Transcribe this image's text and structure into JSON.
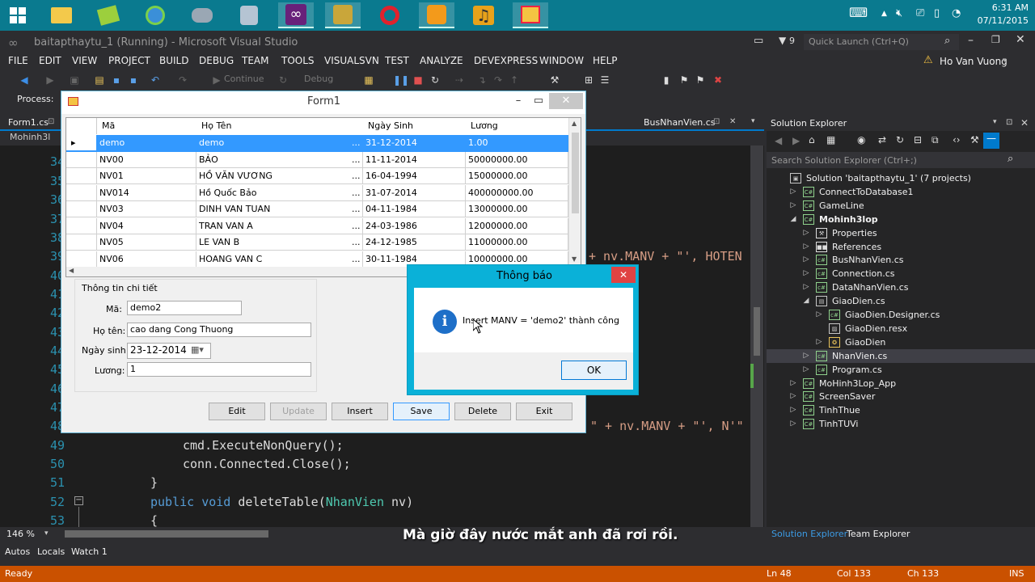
{
  "taskbar": {
    "clock_time": "6:31 AM",
    "clock_date": "07/11/2015"
  },
  "vs": {
    "title": "baitapthaytu_1 (Running) - Microsoft Visual Studio",
    "notifications": "9",
    "quick_launch_placeholder": "Quick Launch (Ctrl+Q)",
    "user_name": "Ho Van Vuong",
    "menu": [
      "FILE",
      "EDIT",
      "VIEW",
      "PROJECT",
      "BUILD",
      "DEBUG",
      "TEAM",
      "TOOLS",
      "VISUALSVN",
      "TEST",
      "ANALYZE",
      "DEVEXPRESS",
      "WINDOW",
      "HELP"
    ],
    "continue_label": "Continue",
    "config_label": "Debug",
    "process_label": "Process:",
    "doc_tab_left": "Form1.cs",
    "doc_tab_right": "BusNhanVien.cs",
    "nav_left": "Mohinh3l",
    "zoom": "146 %"
  },
  "editor": {
    "line_numbers": [
      "34",
      "35",
      "36",
      "37",
      "38",
      "39",
      "40",
      "41",
      "42",
      "43",
      "44",
      "45",
      "46",
      "47",
      "48",
      "49",
      "50",
      "51",
      "52",
      "53"
    ],
    "frag_39": "+ nv.MANV + \"', HOTEN",
    "frag_48": "\" + nv.MANV + \"', N'\"",
    "line_49": "cmd.ExecuteNonQuery();",
    "line_50": "conn.Connected.Close();",
    "line_51": "}",
    "line_52_kw1": "public",
    "line_52_kw2": "void",
    "line_52_name": "deleteTable(",
    "line_52_type": "NhanVien",
    "line_52_rest": " nv)",
    "line_53": "{"
  },
  "solution_explorer": {
    "title": "Solution Explorer",
    "search_placeholder": "Search Solution Explorer (Ctrl+;)",
    "items": [
      {
        "label": "Solution 'baitapthaytu_1' (7 projects)",
        "indent": 0,
        "arrow": "",
        "icon": "solution-icon",
        "bold": false
      },
      {
        "label": "ConnectToDatabase1",
        "indent": 1,
        "arrow": "▷",
        "icon": "csharp-project-icon",
        "bold": false
      },
      {
        "label": "GameLine",
        "indent": 1,
        "arrow": "▷",
        "icon": "csharp-project-icon",
        "bold": false
      },
      {
        "label": "Mohinh3lop",
        "indent": 1,
        "arrow": "◢",
        "icon": "csharp-project-icon",
        "bold": true
      },
      {
        "label": "Properties",
        "indent": 2,
        "arrow": "▷",
        "icon": "wrench-icon",
        "bold": false
      },
      {
        "label": "References",
        "indent": 2,
        "arrow": "▷",
        "icon": "references-icon",
        "bold": false
      },
      {
        "label": "BusNhanVien.cs",
        "indent": 2,
        "arrow": "▷",
        "icon": "csharp-file-icon",
        "bold": false
      },
      {
        "label": "Connection.cs",
        "indent": 2,
        "arrow": "▷",
        "icon": "csharp-file-icon",
        "bold": false
      },
      {
        "label": "DataNhanVien.cs",
        "indent": 2,
        "arrow": "▷",
        "icon": "csharp-file-icon",
        "bold": false
      },
      {
        "label": "GiaoDien.cs",
        "indent": 2,
        "arrow": "◢",
        "icon": "form-icon",
        "bold": false
      },
      {
        "label": "GiaoDien.Designer.cs",
        "indent": 3,
        "arrow": "▷",
        "icon": "csharp-file-icon",
        "bold": false
      },
      {
        "label": "GiaoDien.resx",
        "indent": 3,
        "arrow": "",
        "icon": "resx-icon",
        "bold": false
      },
      {
        "label": "GiaoDien",
        "indent": 3,
        "arrow": "▷",
        "icon": "class-icon",
        "bold": false
      },
      {
        "label": "NhanVien.cs",
        "indent": 2,
        "arrow": "▷",
        "icon": "csharp-file-icon",
        "bold": false,
        "selected": true
      },
      {
        "label": "Program.cs",
        "indent": 2,
        "arrow": "▷",
        "icon": "csharp-file-icon",
        "bold": false
      },
      {
        "label": "MoHinh3Lop_App",
        "indent": 1,
        "arrow": "▷",
        "icon": "csharp-project-icon",
        "bold": false
      },
      {
        "label": "ScreenSaver",
        "indent": 1,
        "arrow": "▷",
        "icon": "csharp-project-icon",
        "bold": false
      },
      {
        "label": "TinhThue",
        "indent": 1,
        "arrow": "▷",
        "icon": "csharp-project-icon",
        "bold": false
      },
      {
        "label": "TinhTUVi",
        "indent": 1,
        "arrow": "▷",
        "icon": "csharp-project-icon",
        "bold": false
      }
    ],
    "tab_active": "Solution Explorer",
    "tab_other": "Team Explorer"
  },
  "bottom_tabs": [
    "Autos",
    "Locals",
    "Watch 1"
  ],
  "status": {
    "ready": "Ready",
    "ln": "Ln 48",
    "col": "Col 133",
    "ch": "Ch 133",
    "ins": "INS"
  },
  "form1": {
    "title": "Form1",
    "columns": [
      "Mã",
      "Họ Tên",
      "Ngày Sinh",
      "Lương"
    ],
    "rows": [
      [
        "demo",
        "demo",
        "31-12-2014",
        "1.00"
      ],
      [
        "NV00",
        "BẢO",
        "11-11-2014",
        "50000000.00"
      ],
      [
        "NV01",
        "HỒ VĂN VƯƠNG",
        "16-04-1994",
        "15000000.00"
      ],
      [
        "NV014",
        "Hồ Quốc Bảo",
        "31-07-2014",
        "400000000.00"
      ],
      [
        "NV03",
        "DINH VAN TUAN",
        "04-11-1984",
        "13000000.00"
      ],
      [
        "NV04",
        "TRAN VAN A",
        "24-03-1986",
        "12000000.00"
      ],
      [
        "NV05",
        "LE VAN B",
        "24-12-1985",
        "11000000.00"
      ],
      [
        "NV06",
        "HOANG VAN C",
        "30-11-1984",
        "10000000.00"
      ]
    ],
    "group_title": "Thông tin chi tiết",
    "lbl_ma": "Mã:",
    "lbl_hoten": "Họ tên:",
    "lbl_ngaysinh": "Ngày sinh:",
    "lbl_luong": "Lương:",
    "val_ma": "demo2",
    "val_hoten": "cao dang Cong Thuong",
    "val_ngaysinh": "23-12-2014",
    "val_luong": "1",
    "btn_edit": "Edit",
    "btn_update": "Update",
    "btn_insert": "Insert",
    "btn_save": "Save",
    "btn_delete": "Delete",
    "btn_exit": "Exit"
  },
  "msgbox": {
    "title": "Thông báo",
    "message": "Insert MANV = 'demo2' thành công",
    "ok": "OK"
  },
  "subtitle": "Mà giờ đây nước mắt anh đã rơi rồi."
}
